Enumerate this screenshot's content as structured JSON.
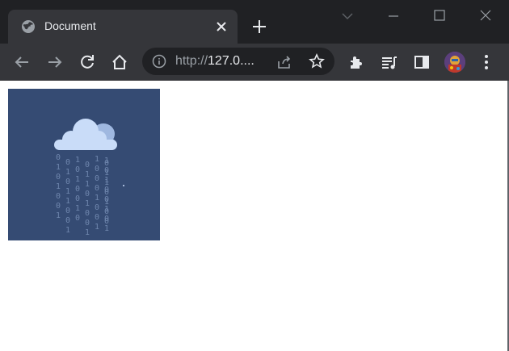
{
  "browser": {
    "tab": {
      "title": "Document",
      "icon": "globe-icon",
      "close_icon": "close-icon"
    },
    "new_tab_icon": "plus-icon",
    "window_controls": [
      "chevron-down-icon",
      "minimize-icon",
      "maximize-icon",
      "close-window-icon"
    ],
    "nav": {
      "back_icon": "back-arrow-icon",
      "forward_icon": "forward-arrow-icon",
      "reload_icon": "reload-icon",
      "home_icon": "home-icon"
    },
    "omnibox": {
      "info_icon": "info-icon",
      "url_scheme": "http://",
      "url_host": "127.0....",
      "share_icon": "share-icon",
      "star_icon": "star-icon"
    },
    "toolbar_icons": [
      "extensions-icon",
      "media-queue-icon",
      "side-panel-icon",
      "profile-avatar",
      "menu-icon"
    ]
  },
  "page": {
    "illustration": {
      "icon": "cloud-binary-rain-icon",
      "background_color": "#354b73",
      "cloud_color": "#c9dcf8",
      "digit_color": "#6f86ad",
      "rain_columns": [
        "0101001",
        "01011001",
        "1010010",
        "01101001",
        "10001001",
        "0110100",
        "10100101"
      ]
    }
  },
  "colors": {
    "titlebar": "#202124",
    "tab_active": "#35363a",
    "toolbar": "#35363a",
    "omnibox": "#202124",
    "text_primary": "#e8eaed",
    "text_secondary": "#9aa0a6"
  }
}
